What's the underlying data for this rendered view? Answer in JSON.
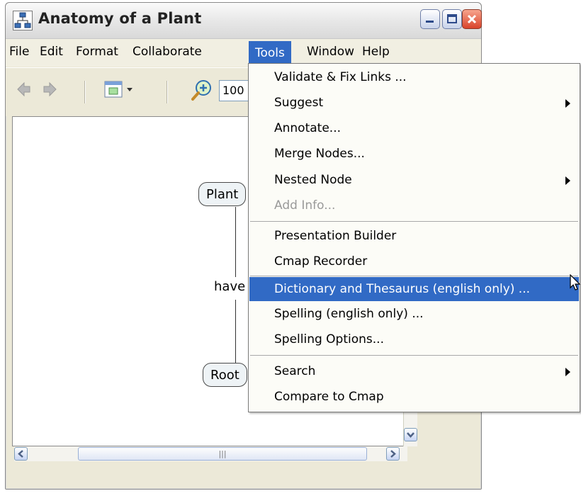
{
  "window": {
    "title": "Anatomy of a Plant"
  },
  "menubar": {
    "items": [
      "File",
      "Edit",
      "Format",
      "Collaborate",
      "Tools",
      "Window",
      "Help"
    ]
  },
  "toolbar": {
    "zoom_value": "100"
  },
  "canvas": {
    "nodes": [
      "Plant",
      "Root"
    ],
    "link_label": "have"
  },
  "tools_menu": {
    "items": [
      {
        "label": "Validate & Fix Links ...",
        "submenu": false,
        "enabled": true
      },
      {
        "label": "Suggest",
        "submenu": true,
        "enabled": true
      },
      {
        "label": "Annotate...",
        "submenu": false,
        "enabled": true
      },
      {
        "label": "Merge Nodes...",
        "submenu": false,
        "enabled": true
      },
      {
        "label": "Nested Node",
        "submenu": true,
        "enabled": true
      },
      {
        "label": "Add Info...",
        "submenu": false,
        "enabled": false
      },
      {
        "label": "Presentation Builder",
        "submenu": false,
        "enabled": true
      },
      {
        "label": "Cmap Recorder",
        "submenu": false,
        "enabled": true
      },
      {
        "label": "Dictionary and Thesaurus (english only) ...",
        "submenu": false,
        "enabled": true,
        "highlighted": true
      },
      {
        "label": "Spelling (english only) ...",
        "submenu": false,
        "enabled": true
      },
      {
        "label": "Spelling Options...",
        "submenu": false,
        "enabled": true
      },
      {
        "label": "Search",
        "submenu": true,
        "enabled": true
      },
      {
        "label": "Compare to Cmap",
        "submenu": false,
        "enabled": true
      }
    ]
  },
  "colors": {
    "menu_highlight": "#316ac5",
    "window_face": "#ece9d8",
    "node_fill": "#eef3f6"
  }
}
